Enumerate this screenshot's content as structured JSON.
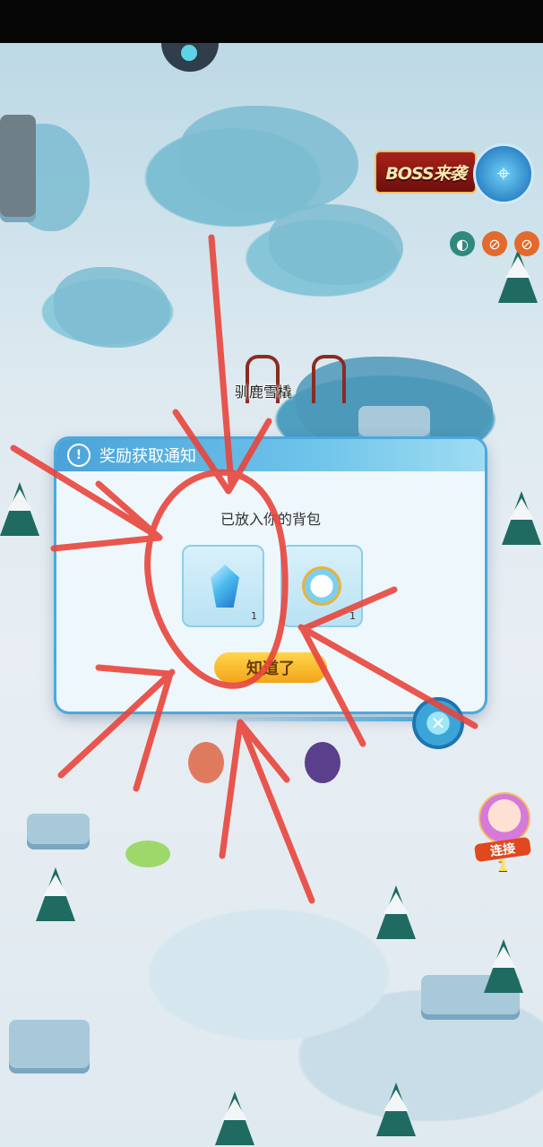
{
  "hud": {
    "boss_banner": "BOSS来袭",
    "map_icon": "map-icon"
  },
  "npc": {
    "name": "驯鹿雪橇"
  },
  "dialog": {
    "title": "奖励获取通知",
    "subtitle": "已放入你的背包",
    "items": [
      {
        "icon": "blue-crystal-icon",
        "count": "1"
      },
      {
        "icon": "golden-compass-icon",
        "count": "1"
      }
    ],
    "confirm_label": "知道了"
  },
  "combo": {
    "label": "连接",
    "count": "1"
  },
  "colors": {
    "dialog_header": "#4aa2d8",
    "confirm_button": "#f2a51b",
    "annotation": "#e8453c"
  }
}
